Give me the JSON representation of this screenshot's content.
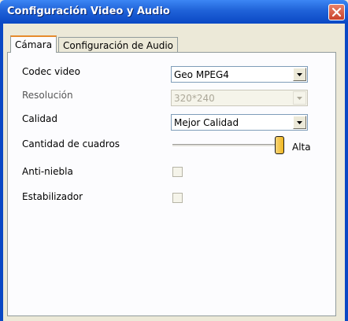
{
  "window": {
    "title": "Configuración Video y Audio"
  },
  "tabs": [
    {
      "label": "Cámara",
      "active": true
    },
    {
      "label": "Configuración de Audio",
      "active": false
    }
  ],
  "camera": {
    "codec": {
      "label": "Codec video",
      "value": "Geo MPEG4"
    },
    "resolution": {
      "label": "Resolución",
      "value": "320*240",
      "disabled": true
    },
    "quality": {
      "label": "Calidad",
      "value": "Mejor Calidad"
    },
    "frame_rate": {
      "label": "Cantidad de cuadros",
      "value_label": "Alta",
      "level": 1.0
    },
    "anti_fog": {
      "label": "Anti-niebla",
      "checked": false,
      "disabled": true
    },
    "stabilizer": {
      "label": "Estabilizador",
      "checked": false,
      "disabled": true
    }
  },
  "colors": {
    "titlebar": "#0a48c4",
    "window_bg": "#ece9d8",
    "close_button": "#c9412a",
    "slider_thumb": "#f0b620"
  }
}
